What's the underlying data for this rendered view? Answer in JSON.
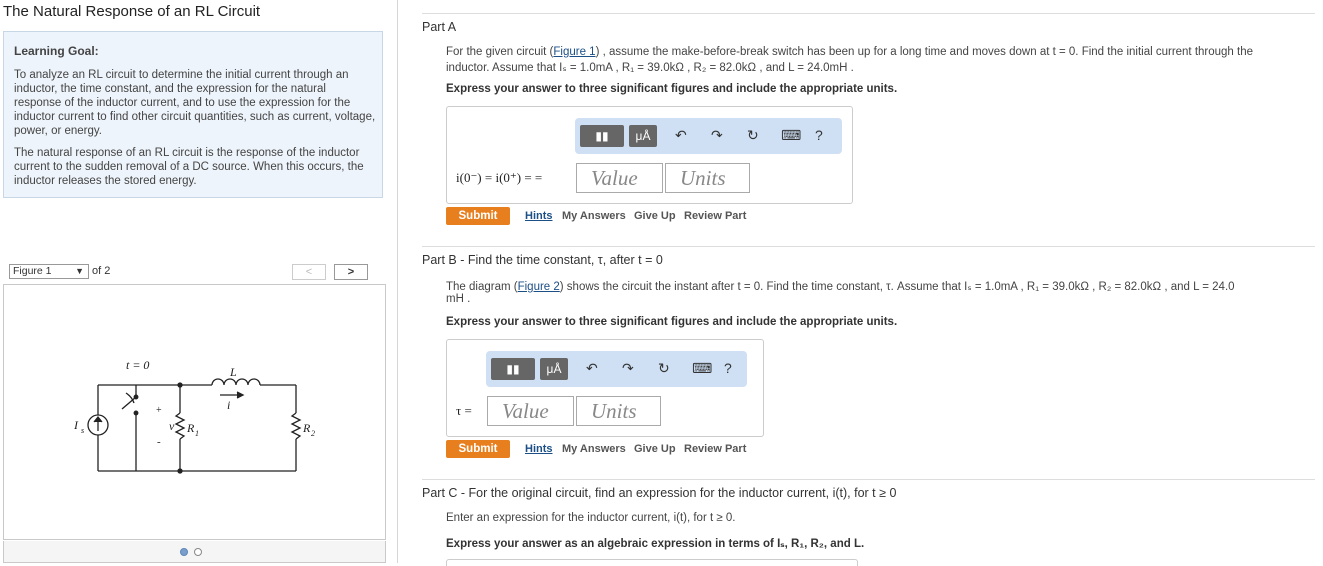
{
  "header": {
    "title": "The Natural Response of an RL Circuit"
  },
  "learning_goal": {
    "label": "Learning Goal:",
    "paragraph1": "To analyze an RL circuit to determine the initial current through an inductor, the time constant, and the expression for the natural response of the inductor current, and to use the expression for the inductor current to find other circuit quantities, such as current, voltage, power, or energy.",
    "paragraph2": "The natural response of an RL circuit is the response of the inductor current to the sudden removal of a DC source. When this occurs, the inductor releases the stored energy."
  },
  "figure": {
    "select_value": "Figure 1",
    "of_text": "of 2",
    "prev": "<",
    "next": ">",
    "labels": {
      "t0": "t = 0",
      "L": "L",
      "i": "i",
      "Is": "I",
      "Is_sub": "s",
      "v": "v",
      "plus": "+",
      "minus": "-",
      "R1": "R",
      "R1_sub": "1",
      "R2": "R",
      "R2_sub": "2"
    }
  },
  "parts": {
    "a": {
      "title": "Part A",
      "q_pre": "For the given circuit (",
      "q_link": "Figure 1",
      "q_post": ") , assume the make-before-break switch has been up for a long time and moves down at t = 0. Find the initial current through the",
      "q_line2": "inductor. Assume that Iₛ = 1.0mA , R₁ = 39.0kΩ , R₂ = 82.0kΩ , and L = 24.0mH .",
      "instruction": "Express your answer to three significant figures and include the appropriate units.",
      "eq_label": "i(0⁻) = i(0⁺) = =",
      "value_placeholder": "Value",
      "units_placeholder": "Units",
      "submit": "Submit",
      "hints": "Hints",
      "my_answers": "My Answers",
      "give_up": "Give Up",
      "review": "Review Part"
    },
    "b": {
      "title": "Part B - Find the time constant, τ, after t = 0",
      "q_pre": "The diagram (",
      "q_link": "Figure 2",
      "q_post": ") shows the circuit the instant after t = 0. Find the time constant, τ. Assume that Iₛ = 1.0mA , R₁ = 39.0kΩ , R₂ = 82.0kΩ , and L = 24.0",
      "q_line2": "mH .",
      "instruction": "Express your answer to three significant figures and include the appropriate units.",
      "eq_label": "τ =",
      "value_placeholder": "Value",
      "units_placeholder": "Units",
      "submit": "Submit",
      "hints": "Hints",
      "my_answers": "My Answers",
      "give_up": "Give Up",
      "review": "Review Part"
    },
    "c": {
      "title": "Part C - For the original circuit, find an expression for the inductor current, i(t), for t ≥ 0",
      "q_line1": "Enter an expression for the inductor current, i(t), for t ≥ 0.",
      "instruction": "Express your answer as an algebraic expression in terms of Iₛ, R₁, R₂, and L."
    }
  },
  "toolbar": {
    "micro_a": "μÅ",
    "undo": "↶",
    "redo": "↷",
    "reset": "↻",
    "keyboard": "⌨",
    "help": "?"
  }
}
